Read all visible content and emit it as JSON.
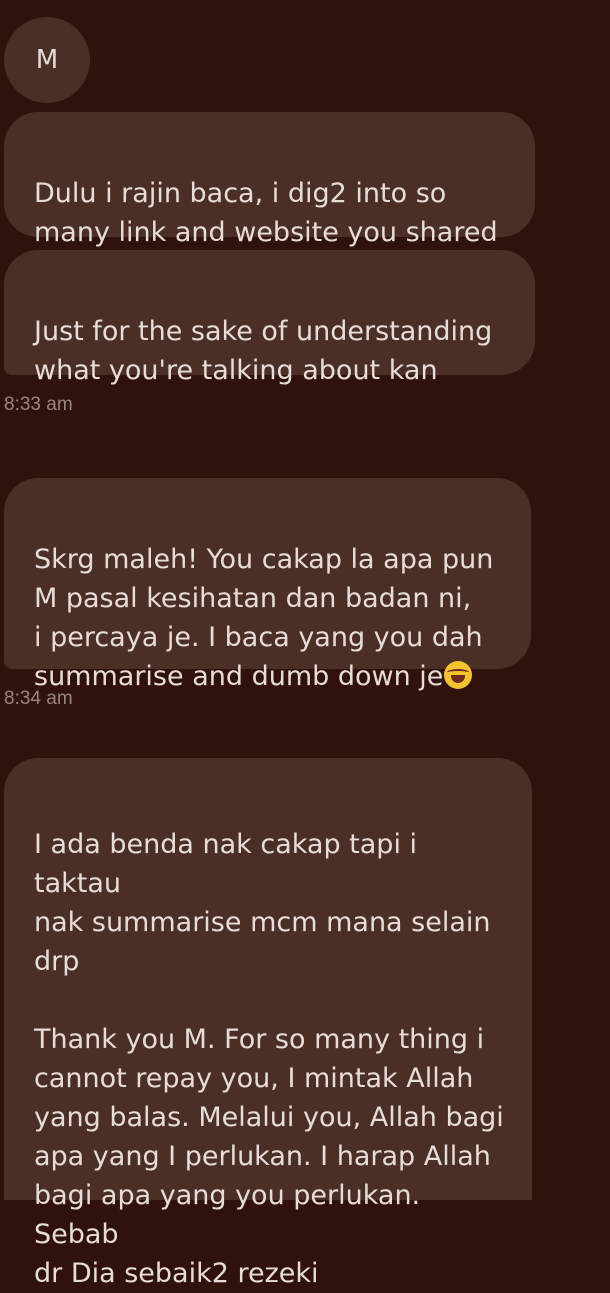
{
  "contact": {
    "avatar_initial": "M"
  },
  "messages": [
    {
      "text": "Dulu i rajin baca, i dig2 into so\nmany link and website you shared"
    },
    {
      "text": "Just for the sake of understanding\nwhat you're talking about kan"
    },
    {
      "text": "Skrg maleh! You cakap la apa pun\nM pasal kesihatan dan badan ni,\ni percaya je. I baca yang you dah\nsummarise and dumb down je",
      "emoji": "face-with-tears-of-joy"
    },
    {
      "text": "I ada benda nak cakap tapi i taktau\nnak summarise mcm mana selain\ndrp\n\nThank you M. For so many thing i\ncannot repay you, I mintak Allah\nyang balas. Melalui you, Allah bagi\napa yang I perlukan. I harap Allah\nbagi apa yang you perlukan. Sebab\ndr Dia sebaik2 rezeki"
    }
  ],
  "timestamps": [
    "8:33 am",
    "8:34 am"
  ],
  "colors": {
    "background": "#2f120b",
    "bubble": "#4a2f27",
    "text": "#e9dcd6",
    "timestamp": "#9a8480"
  }
}
